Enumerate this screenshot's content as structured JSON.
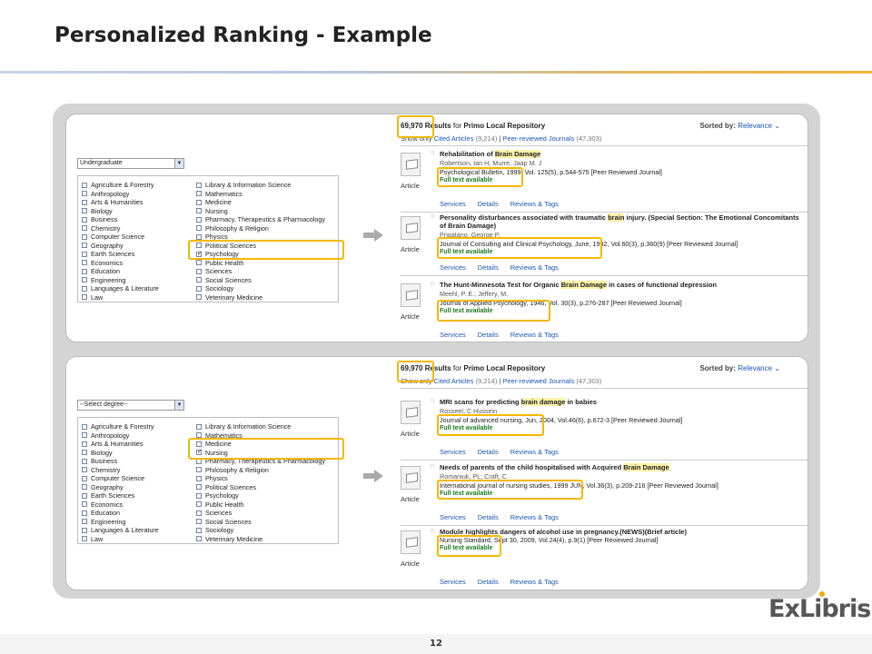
{
  "slide": {
    "title": "Personalized Ranking - Example",
    "page_number": "12",
    "logo_text": "ExLibris",
    "accent_color": "#f5b800"
  },
  "panel1": {
    "degree_select": "Undergraduate",
    "subjects_left": [
      "Agriculture & Forestry",
      "Anthropology",
      "Arts & Humanities",
      "Biology",
      "Business",
      "Chemistry",
      "Computer Science",
      "Geography",
      "Earth Sciences",
      "Economics",
      "Education",
      "Engineering",
      "Languages & Literature",
      "Law"
    ],
    "subjects_right": [
      "Library & Information Science",
      "Mathematics",
      "Medicine",
      "Nursing",
      "Pharmacy, Therapeutics & Pharmacology",
      "Philosophy & Religion",
      "Physics",
      "Political Sciences",
      "Psychology",
      "Public Health",
      "Sciences",
      "Social Sciences",
      "Sociology",
      "Veterinary Medicine"
    ],
    "checked_subject": "Psychology",
    "results_count": "69,970",
    "results_label": "Results",
    "results_for": "for",
    "repository": "Primo Local Repository",
    "sorted_by": "Sorted by:",
    "sort_value": "Relevance",
    "show_only": "Show only",
    "cited_articles": "Cited Articles",
    "cited_count": "(9,214)",
    "peer_reviewed": "Peer-reviewed Journals",
    "peer_count": "(47,303)",
    "records": [
      {
        "title_pre": "Rehabilitation of ",
        "title_hl": "Brain Damage",
        "title_post": "",
        "author": "Robertson, Ian H; Murre, Jaap M. J",
        "source": "Psychological Bulletin, 1999, Vol. 125(5), p.544-575 [Peer Reviewed Journal]",
        "fulltext": "Full text available",
        "type": "Article"
      },
      {
        "title_pre": "Personality disturbances associated with traumatic ",
        "title_hl": "brain",
        "title_post": " injury. (Special Section: The Emotional Concomitants of Brain Damage)",
        "author": "Prigatano, George P.",
        "source": "Journal of Consulting and Clinical Psychology, June, 1992, Vol.60(3), p.360(9) [Peer Reviewed Journal]",
        "fulltext": "Full text available",
        "type": "Article"
      },
      {
        "title_pre": "The Hunt-Minnesota Test for Organic ",
        "title_hl": "Brain Damage",
        "title_post": " in cases of functional depression",
        "author": "Meehl, P. E.; Jeffery, M.",
        "source": "Journal of Applied Psychology, 1946, Vol. 30(3), p.276-287 [Peer Reviewed Journal]",
        "fulltext": "Full text available",
        "type": "Article"
      }
    ]
  },
  "panel2": {
    "degree_select": "--Select degree--",
    "subjects_left": [
      "Agriculture & Forestry",
      "Anthropology",
      "Arts & Humanities",
      "Biology",
      "Business",
      "Chemistry",
      "Computer Science",
      "Geography",
      "Earth Sciences",
      "Economics",
      "Education",
      "Engineering",
      "Languages & Literature",
      "Law"
    ],
    "subjects_right": [
      "Library & Information Science",
      "Mathematics",
      "Medicine",
      "Nursing",
      "Pharmacy, Therapeutics & Pharmacology",
      "Philosophy & Religion",
      "Physics",
      "Political Sciences",
      "Psychology",
      "Public Health",
      "Sciences",
      "Social Sciences",
      "Sociology",
      "Veterinary Medicine"
    ],
    "checked_subject": "Nursing",
    "results_count": "69,970",
    "results_label": "Results",
    "results_for": "for",
    "repository": "Primo Local Repository",
    "sorted_by": "Sorted by:",
    "sort_value": "Relevance",
    "show_only": "Show only",
    "cited_articles": "Cited Articles",
    "cited_count": "(9,214)",
    "peer_reviewed": "Peer-reviewed Journals",
    "peer_count": "(47,303)",
    "records": [
      {
        "title_pre": "MRI scans for predicting ",
        "title_hl": "brain damage",
        "title_post": " in babies",
        "author": "Rosseel, C Hussein",
        "source": "Journal of advanced nursing, Jun, 2004, Vol.46(6), p.672-3 [Peer Reviewed Journal]",
        "fulltext": "Full text available",
        "type": "Article"
      },
      {
        "title_pre": "Needs of parents of the child hospitalised with Acquired ",
        "title_hl": "Brain Damage",
        "title_post": "",
        "author": "Romaniuk, PL; Craft, C",
        "source": "International journal of nursing studies, 1999 JUN, Vol.36(3), p.209-216 [Peer Reviewed Journal]",
        "fulltext": "Full text available",
        "type": "Article"
      },
      {
        "title_pre": "Module highlights dangers of alcohol use in pregnancy.(NEWS)(Brief article)",
        "title_hl": "",
        "title_post": "",
        "author": "",
        "source": "Nursing Standard, Sept 30, 2009, Vol.24(4), p.9(1) [Peer Reviewed Journal]",
        "fulltext": "Full text available",
        "type": "Article"
      }
    ]
  },
  "actions": {
    "services": "Services",
    "details": "Details",
    "reviews": "Reviews & Tags"
  }
}
